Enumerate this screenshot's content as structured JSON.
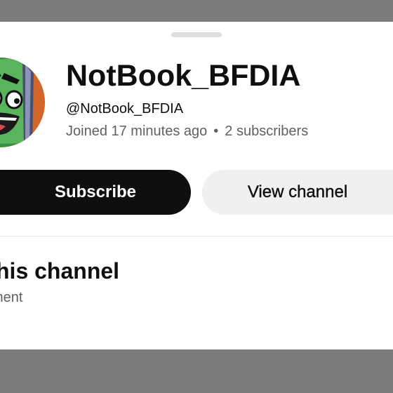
{
  "channel": {
    "name": "NotBook_BFDIA",
    "handle": "@NotBook_BFDIA",
    "joined": "Joined 17 minutes ago",
    "separator": "•",
    "subscribers": "2 subscribers"
  },
  "actions": {
    "subscribe_label": "Subscribe",
    "view_channel_label": "View channel"
  },
  "section": {
    "title": "his channel",
    "subtitle": "ment"
  },
  "colors": {
    "overlay": "#7b7b7b",
    "sheet": "#ffffff",
    "primary_button": "#0f0f0f",
    "secondary_button": "#f0f0f0",
    "secondary_text": "#606060"
  }
}
